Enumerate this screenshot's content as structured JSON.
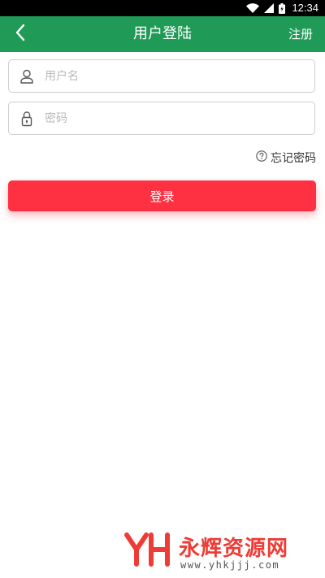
{
  "status_bar": {
    "time": "12:34",
    "icons": [
      "wifi-icon",
      "signal-icon",
      "battery-icon"
    ]
  },
  "app_bar": {
    "title": "用户登陆",
    "back_icon": "chevron-left-icon",
    "register_label": "注册",
    "background": "#1f9a57"
  },
  "form": {
    "username": {
      "placeholder": "用户名",
      "value": "",
      "icon": "user-icon"
    },
    "password": {
      "placeholder": "密码",
      "value": "",
      "icon": "lock-icon"
    },
    "forgot_label": "忘记密码",
    "forgot_icon": "question-circle-icon",
    "login_label": "登录",
    "login_color": "#fd3142"
  },
  "watermark": {
    "name": "永辉资源网",
    "url": "www.yhkjjj.com",
    "color": "#ef3b35"
  }
}
